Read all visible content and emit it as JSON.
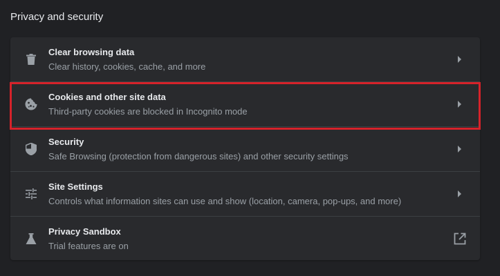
{
  "section": {
    "title": "Privacy and security"
  },
  "rows": [
    {
      "label": "Clear browsing data",
      "sub": "Clear history, cookies, cache, and more",
      "icon": "trash-icon",
      "action": "arrow"
    },
    {
      "label": "Cookies and other site data",
      "sub": "Third-party cookies are blocked in Incognito mode",
      "icon": "cookie-icon",
      "action": "arrow"
    },
    {
      "label": "Security",
      "sub": "Safe Browsing (protection from dangerous sites) and other security settings",
      "icon": "shield-icon",
      "action": "arrow"
    },
    {
      "label": "Site Settings",
      "sub": "Controls what information sites can use and show (location, camera, pop-ups, and more)",
      "icon": "tune-sliders-icon",
      "action": "arrow"
    },
    {
      "label": "Privacy Sandbox",
      "sub": "Trial features are on",
      "icon": "flask-icon",
      "action": "external"
    }
  ],
  "colors": {
    "background": "#202124",
    "card": "#292a2d",
    "divider": "#3c4043",
    "text_primary": "#e8eaed",
    "text_secondary": "#9aa0a6",
    "highlight_border": "#d6222a"
  }
}
